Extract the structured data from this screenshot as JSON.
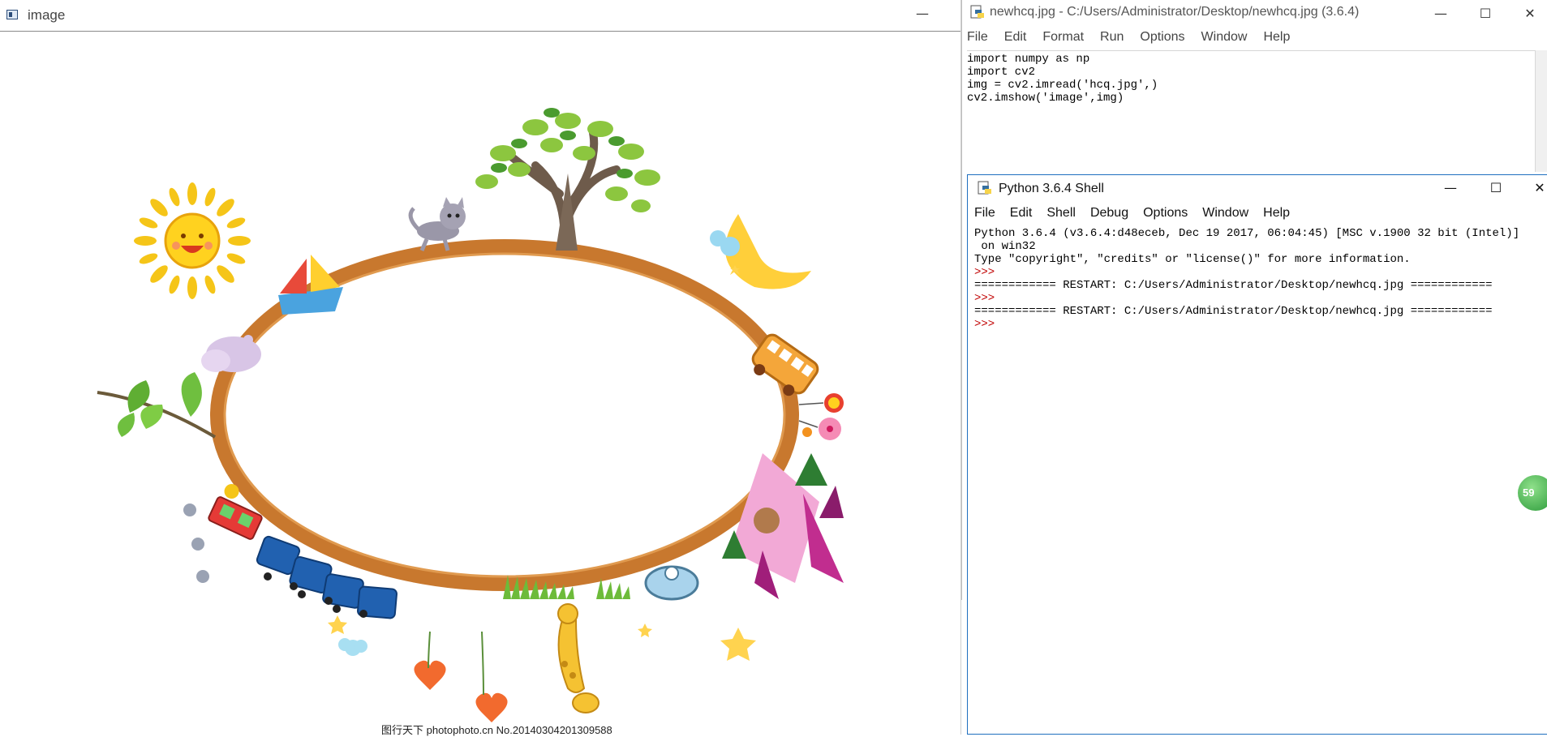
{
  "image_window": {
    "title": "image",
    "minimize_glyph": "—",
    "caption": "图行天下 photophoto.cn No.20140304201309588"
  },
  "editor_window": {
    "title": "newhcq.jpg - C:/Users/Administrator/Desktop/newhcq.jpg (3.6.4)",
    "controls": {
      "minimize": "—",
      "maximize": "☐",
      "close": "✕"
    },
    "menu": [
      "File",
      "Edit",
      "Format",
      "Run",
      "Options",
      "Window",
      "Help"
    ],
    "code_lines": [
      "import numpy as np",
      "import cv2",
      "img = cv2.imread('hcq.jpg',)",
      "cv2.imshow('image',img)"
    ]
  },
  "shell_window": {
    "title": "Python 3.6.4 Shell",
    "controls": {
      "minimize": "—",
      "maximize": "☐",
      "close": "✕"
    },
    "menu": [
      "File",
      "Edit",
      "Shell",
      "Debug",
      "Options",
      "Window",
      "Help"
    ],
    "banner_line1": "Python 3.6.4 (v3.6.4:d48eceb, Dec 19 2017, 06:04:45) [MSC v.1900 32 bit (Intel)]",
    "banner_line2": " on win32",
    "banner_line3": "Type \"copyright\", \"credits\" or \"license()\" for more information.",
    "prompt": ">>>",
    "restart_line": "============ RESTART: C:/Users/Administrator/Desktop/newhcq.jpg ============",
    "badge": "59"
  },
  "colors": {
    "oval_frame": "#c8782e",
    "prompt": "#c00000",
    "shell_border": "#1f6fbf"
  }
}
